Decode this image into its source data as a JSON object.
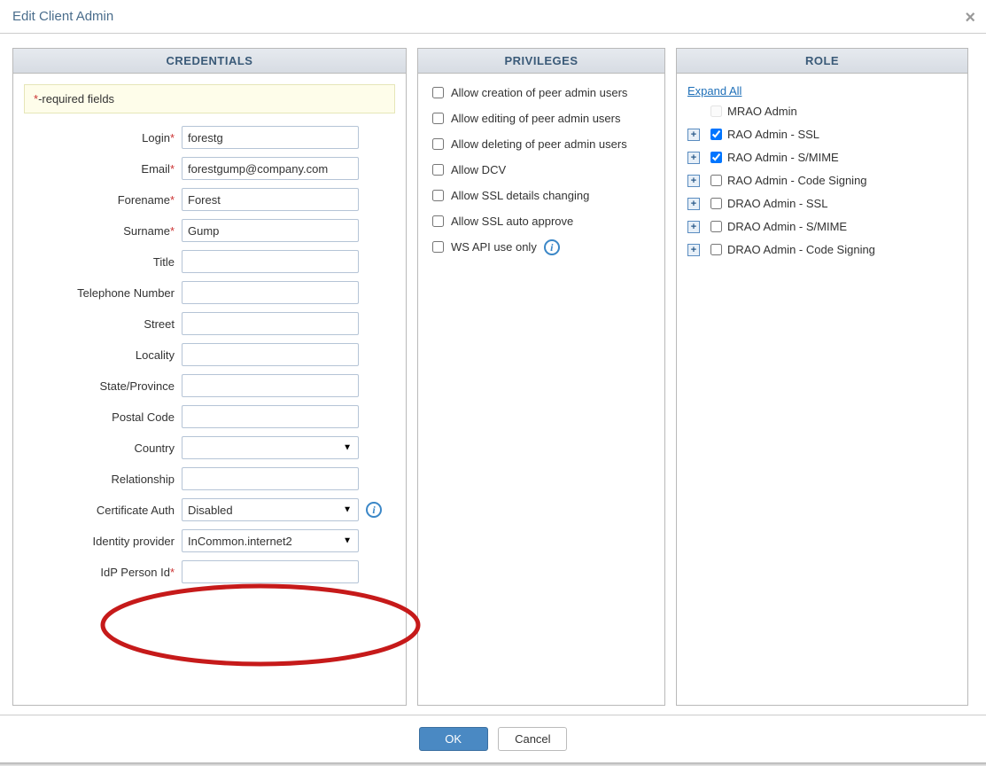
{
  "dialog": {
    "title": "Edit Client Admin",
    "required_note_prefix": "*",
    "required_note_text": "-required fields"
  },
  "panels": {
    "credentials_title": "CREDENTIALS",
    "privileges_title": "PRIVILEGES",
    "role_title": "ROLE"
  },
  "fields": {
    "login": {
      "label": "Login",
      "value": "forestg"
    },
    "email": {
      "label": "Email",
      "value": "forestgump@company.com"
    },
    "forename": {
      "label": "Forename",
      "value": "Forest"
    },
    "surname": {
      "label": "Surname",
      "value": "Gump"
    },
    "title": {
      "label": "Title",
      "value": ""
    },
    "telephone": {
      "label": "Telephone Number",
      "value": ""
    },
    "street": {
      "label": "Street",
      "value": ""
    },
    "locality": {
      "label": "Locality",
      "value": ""
    },
    "state": {
      "label": "State/Province",
      "value": ""
    },
    "postal": {
      "label": "Postal Code",
      "value": ""
    },
    "country": {
      "label": "Country",
      "value": ""
    },
    "relationship": {
      "label": "Relationship",
      "value": ""
    },
    "cert_auth": {
      "label": "Certificate Auth",
      "value": "Disabled"
    },
    "identity_provider": {
      "label": "Identity provider",
      "value": "InCommon.internet2"
    },
    "idp_person_id": {
      "label": "IdP Person Id",
      "value": ""
    }
  },
  "privileges": {
    "items": [
      {
        "label": "Allow creation of peer admin users",
        "checked": false
      },
      {
        "label": "Allow editing of peer admin users",
        "checked": false
      },
      {
        "label": "Allow deleting of peer admin users",
        "checked": false
      },
      {
        "label": "Allow DCV",
        "checked": false
      },
      {
        "label": "Allow SSL details changing",
        "checked": false
      },
      {
        "label": "Allow SSL auto approve",
        "checked": false
      },
      {
        "label": "WS API use only",
        "checked": false,
        "info": true
      }
    ]
  },
  "roles": {
    "expand_all": "Expand All",
    "items": [
      {
        "label": "MRAO Admin",
        "checked": false,
        "expandable": false,
        "disabled": true
      },
      {
        "label": "RAO Admin - SSL",
        "checked": true,
        "expandable": true
      },
      {
        "label": "RAO Admin - S/MIME",
        "checked": true,
        "expandable": true
      },
      {
        "label": "RAO Admin - Code Signing",
        "checked": false,
        "expandable": true
      },
      {
        "label": "DRAO Admin - SSL",
        "checked": false,
        "expandable": true
      },
      {
        "label": "DRAO Admin - S/MIME",
        "checked": false,
        "expandable": true
      },
      {
        "label": "DRAO Admin - Code Signing",
        "checked": false,
        "expandable": true
      }
    ]
  },
  "buttons": {
    "ok": "OK",
    "cancel": "Cancel"
  }
}
